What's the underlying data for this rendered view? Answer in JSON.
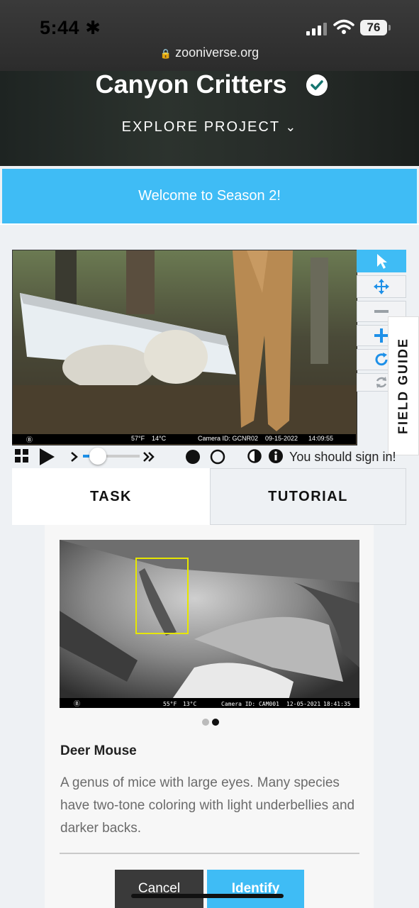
{
  "status_bar": {
    "time": "5:44",
    "battery": "76",
    "url": "zooniverse.org"
  },
  "header": {
    "project_title": "Canyon Critters",
    "explore_label": "EXPLORE PROJECT"
  },
  "banner": {
    "text": "Welcome to Season 2!"
  },
  "subject_image": {
    "caption": {
      "temp_f": "57°F",
      "temp_c": "14°C",
      "camera_id": "Camera ID: GCNR02",
      "date": "09-15-2022",
      "time": "14:09:55"
    }
  },
  "tools": [
    "pointer",
    "move",
    "zoom-out",
    "zoom-in",
    "rotate",
    "reset"
  ],
  "side_tab": {
    "label": "FIELD GUIDE"
  },
  "controls": {
    "signin_text": "You should sign in!"
  },
  "tabs": [
    {
      "label": "TASK"
    },
    {
      "label": "TUTORIAL"
    }
  ],
  "example_image": {
    "caption": {
      "temp_f": "55°F",
      "temp_c": "13°C",
      "camera_id": "Camera ID: CAM001",
      "date": "12-05-2021",
      "time": "18:41:35"
    },
    "pages": 2,
    "active_page": 2
  },
  "species": {
    "name": "Deer Mouse",
    "description": "A genus of mice with large eyes. Many species have two-tone coloring with light underbellies and darker backs."
  },
  "buttons": {
    "cancel": "Cancel",
    "identify": "Identify"
  },
  "colors": {
    "accent": "#3fbcf5",
    "dark_button": "#3a3a3a",
    "verified": "#14756f"
  }
}
